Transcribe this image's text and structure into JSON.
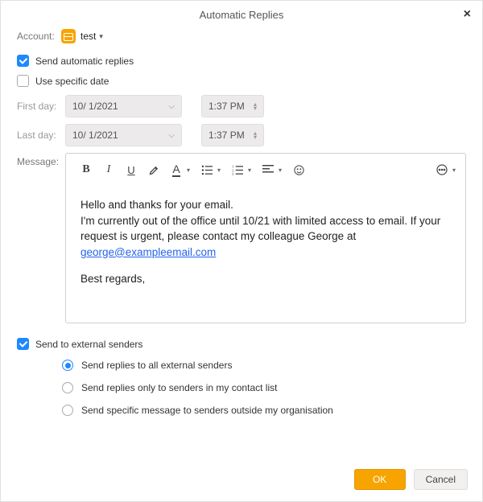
{
  "title": "Automatic Replies",
  "account": {
    "label": "Account:",
    "name": "test"
  },
  "send_auto": {
    "checked": true,
    "label": "Send automatic replies"
  },
  "use_date": {
    "checked": false,
    "label": "Use specific date"
  },
  "first_day": {
    "label": "First day:",
    "date": "10/  1/2021",
    "time": "1:37 PM"
  },
  "last_day": {
    "label": "Last day:",
    "date": "10/  1/2021",
    "time": "1:37 PM"
  },
  "message_label": "Message:",
  "message": {
    "line1": "Hello and thanks for your email.",
    "line2a": "I'm currently out of the office until 10/21 with limited access to email. If your request is urgent, please contact my colleague George at ",
    "email": "george@exampleemail.com",
    "line3": "Best regards,"
  },
  "external": {
    "checked": true,
    "label": "Send to external senders",
    "options": [
      "Send replies to all external senders",
      "Send replies only to senders in my contact list",
      "Send specific message to senders outside my organisation"
    ],
    "selected": 0
  },
  "buttons": {
    "ok": "OK",
    "cancel": "Cancel"
  }
}
